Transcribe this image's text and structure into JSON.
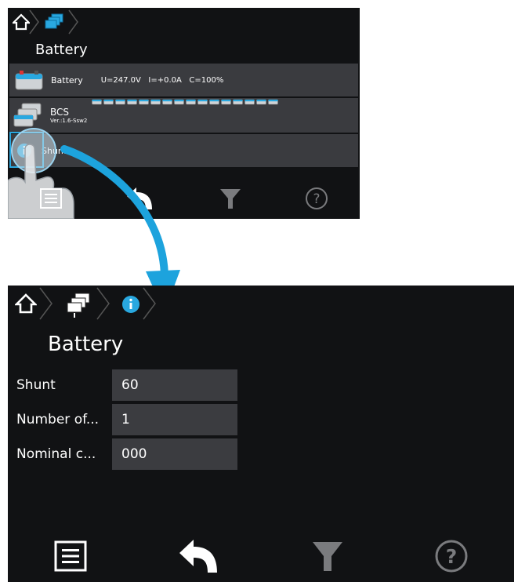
{
  "top_screen": {
    "title": "Battery",
    "breadcrumb": [
      "home-icon",
      "battery-rack-icon"
    ],
    "rows": [
      {
        "label": "Battery",
        "value": "U=247.0V   I=+0.0A   C=100%",
        "icon": "battery-icon"
      },
      {
        "label": "BCS",
        "sublabel": "Ver.:1.6-Ssw2",
        "icon": "battery-stack-icon",
        "cells": 16
      },
      {
        "label": "Shunt",
        "icon": "info-icon"
      }
    ],
    "footer": [
      "menu-icon",
      "back-icon",
      "filter-icon",
      "help-icon"
    ]
  },
  "bottom_screen": {
    "title": "Battery",
    "breadcrumb": [
      "home-icon",
      "battery-rack-icon",
      "info-icon"
    ],
    "fields": [
      {
        "label": "Shunt",
        "value": "60"
      },
      {
        "label": "Number of...",
        "value": "1"
      },
      {
        "label": "Nominal c...",
        "value": "000"
      }
    ],
    "footer": [
      "menu-icon",
      "back-icon",
      "filter-icon",
      "help-icon"
    ]
  },
  "colors": {
    "accent": "#29a8e0",
    "screen_bg": "#111214",
    "row_bg": "#3a3b3f",
    "disabled": "#7a7b7e"
  }
}
